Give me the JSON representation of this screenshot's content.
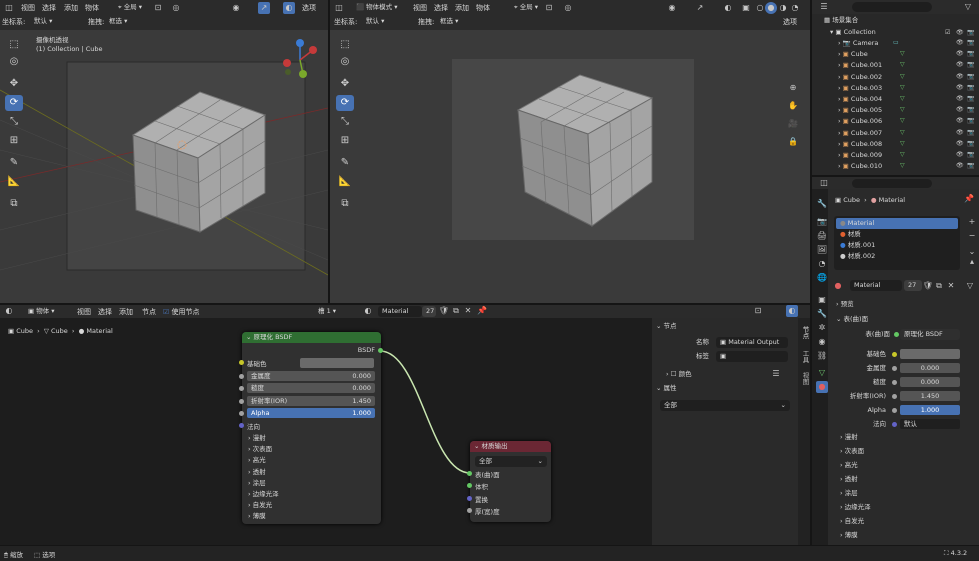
{
  "top_left_header": {
    "view": "视图",
    "select": "选择",
    "add": "添加",
    "object": "物体",
    "transform_global": "全局",
    "snap_label": "拖拽:",
    "snap_value": "框选",
    "options": "选项",
    "coord_label": "坐标系:",
    "coord_value": "默认"
  },
  "top_right_header": {
    "mode": "物体模式",
    "view": "视图",
    "select": "选择",
    "add": "添加",
    "object": "物体",
    "transform_global": "全局",
    "snap_label": "拖拽:",
    "snap_value": "框选",
    "options": "选项",
    "coord_label": "坐标系:",
    "coord_value": "默认"
  },
  "viewport_left": {
    "title": "摄像机透视",
    "subtitle": "(1) Collection | Cube"
  },
  "outliner": {
    "scene": "场景集合",
    "collection": "Collection",
    "items": [
      "Camera",
      "Cube",
      "Cube.001",
      "Cube.002",
      "Cube.003",
      "Cube.004",
      "Cube.005",
      "Cube.006",
      "Cube.007",
      "Cube.008",
      "Cube.009",
      "Cube.010"
    ]
  },
  "props": {
    "breadcrumb_obj": "Cube",
    "breadcrumb_mat": "Material",
    "slots": [
      "Material",
      "材质",
      "材质.001",
      "材质.002"
    ],
    "material_name": "Material",
    "users": "27",
    "preview": "预览",
    "surface_section": "表(曲)面",
    "surface_label": "表(曲)面",
    "surface_value": "原理化 BSDF",
    "rows": [
      {
        "label": "基础色",
        "value": ""
      },
      {
        "label": "金属度",
        "value": "0.000"
      },
      {
        "label": "糙度",
        "value": "0.000"
      },
      {
        "label": "折射率(IOR)",
        "value": "1.450"
      },
      {
        "label": "Alpha",
        "value": "1.000"
      },
      {
        "label": "法向",
        "value": "默认"
      }
    ],
    "subs": [
      "漫射",
      "次表面",
      "高光",
      "透射",
      "涂层",
      "边缘光泽",
      "自发光",
      "薄膜"
    ]
  },
  "node_header": {
    "editor": "物体",
    "view": "视图",
    "select": "选择",
    "add": "添加",
    "node": "节点",
    "use_nodes": "使用节点",
    "slot": "槽 1",
    "material": "Material",
    "users": "27"
  },
  "node_breadcrumb": {
    "a": "Cube",
    "b": "Cube",
    "c": "Material"
  },
  "bsdf_node": {
    "title": "原理化 BSDF",
    "output": "BSDF",
    "base_color": "基础色",
    "fields": [
      {
        "label": "金属度",
        "value": "0.000"
      },
      {
        "label": "糙度",
        "value": "0.000"
      },
      {
        "label": "折射率(IOR)",
        "value": "1.450"
      },
      {
        "label": "Alpha",
        "value": "1.000"
      }
    ],
    "normal": "法向",
    "subs": [
      "漫射",
      "次表面",
      "高光",
      "透射",
      "涂层",
      "边缘光泽",
      "自发光",
      "薄膜"
    ]
  },
  "output_node": {
    "title": "材质输出",
    "target": "全部",
    "sockets": [
      "表(曲)面",
      "体积",
      "置换",
      "厚(宽)度"
    ]
  },
  "node_sidebar": {
    "section": "节点",
    "name_label": "名称",
    "name_value": "Material Output",
    "label_label": "标签",
    "color": "颜色",
    "props": "属性",
    "target": "全部",
    "tabs": [
      "节点",
      "工具",
      "视图"
    ]
  },
  "status": {
    "pan": "缩放",
    "select": "选项",
    "version": "4.3.2"
  },
  "colors": {
    "accent": "#4772b3",
    "bsdf_header": "#2f6e32",
    "output_header": "#6b2734",
    "link": "#c9e6b0",
    "socket_green": "#63c763",
    "socket_yellow": "#c7c729",
    "socket_gray": "#a1a1a1",
    "socket_purple": "#6363c7"
  }
}
